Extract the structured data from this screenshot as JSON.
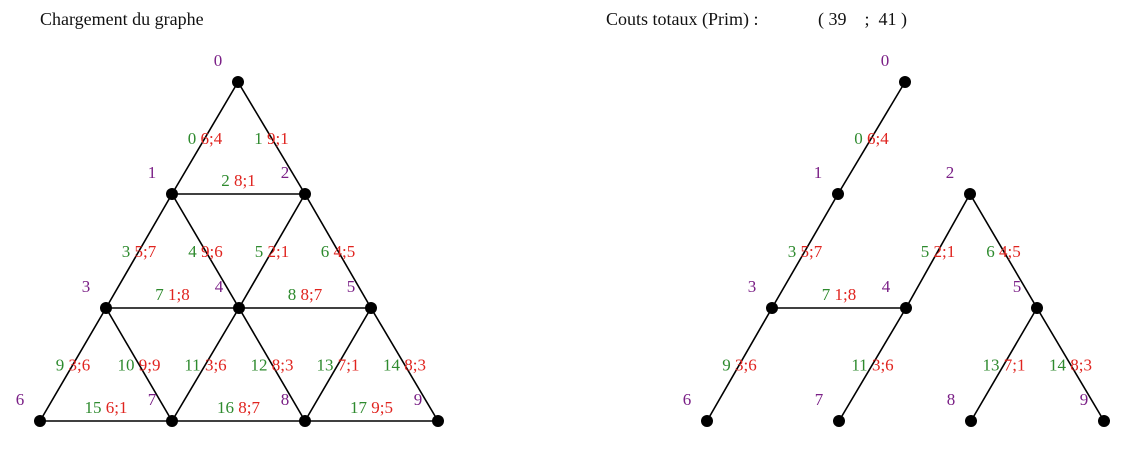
{
  "titles": {
    "left": "Chargement du graphe",
    "right": "Couts totaux (Prim) :",
    "costs": "( 39    ;  41 )"
  },
  "colors": {
    "node_label": "#7a1f86",
    "edge_index": "#2e8a2e",
    "edge_cost": "#e0241f",
    "edge": "#000000"
  },
  "graph": {
    "nodes": [
      "0",
      "1",
      "2",
      "3",
      "4",
      "5",
      "6",
      "7",
      "8",
      "9"
    ],
    "edges": [
      {
        "id": "0",
        "from": "0",
        "to": "1",
        "cost": "6;4"
      },
      {
        "id": "1",
        "from": "0",
        "to": "2",
        "cost": "9;1"
      },
      {
        "id": "2",
        "from": "1",
        "to": "2",
        "cost": "8;1"
      },
      {
        "id": "3",
        "from": "1",
        "to": "3",
        "cost": "5;7"
      },
      {
        "id": "4",
        "from": "1",
        "to": "4",
        "cost": "9;6"
      },
      {
        "id": "5",
        "from": "2",
        "to": "4",
        "cost": "2;1"
      },
      {
        "id": "6",
        "from": "2",
        "to": "5",
        "cost": "4;5"
      },
      {
        "id": "7",
        "from": "3",
        "to": "4",
        "cost": "1;8"
      },
      {
        "id": "8",
        "from": "4",
        "to": "5",
        "cost": "8;7"
      },
      {
        "id": "9",
        "from": "3",
        "to": "6",
        "cost": "3;6"
      },
      {
        "id": "10",
        "from": "3",
        "to": "7",
        "cost": "9;9"
      },
      {
        "id": "11",
        "from": "4",
        "to": "7",
        "cost": "3;6"
      },
      {
        "id": "12",
        "from": "4",
        "to": "8",
        "cost": "8;3"
      },
      {
        "id": "13",
        "from": "5",
        "to": "8",
        "cost": "7;1"
      },
      {
        "id": "14",
        "from": "5",
        "to": "9",
        "cost": "8;3"
      },
      {
        "id": "15",
        "from": "6",
        "to": "7",
        "cost": "6;1"
      },
      {
        "id": "16",
        "from": "7",
        "to": "8",
        "cost": "8;7"
      },
      {
        "id": "17",
        "from": "8",
        "to": "9",
        "cost": "9;5"
      }
    ]
  },
  "prim_tree_edges": [
    "0",
    "3",
    "5",
    "6",
    "7",
    "9",
    "11",
    "13",
    "14"
  ]
}
